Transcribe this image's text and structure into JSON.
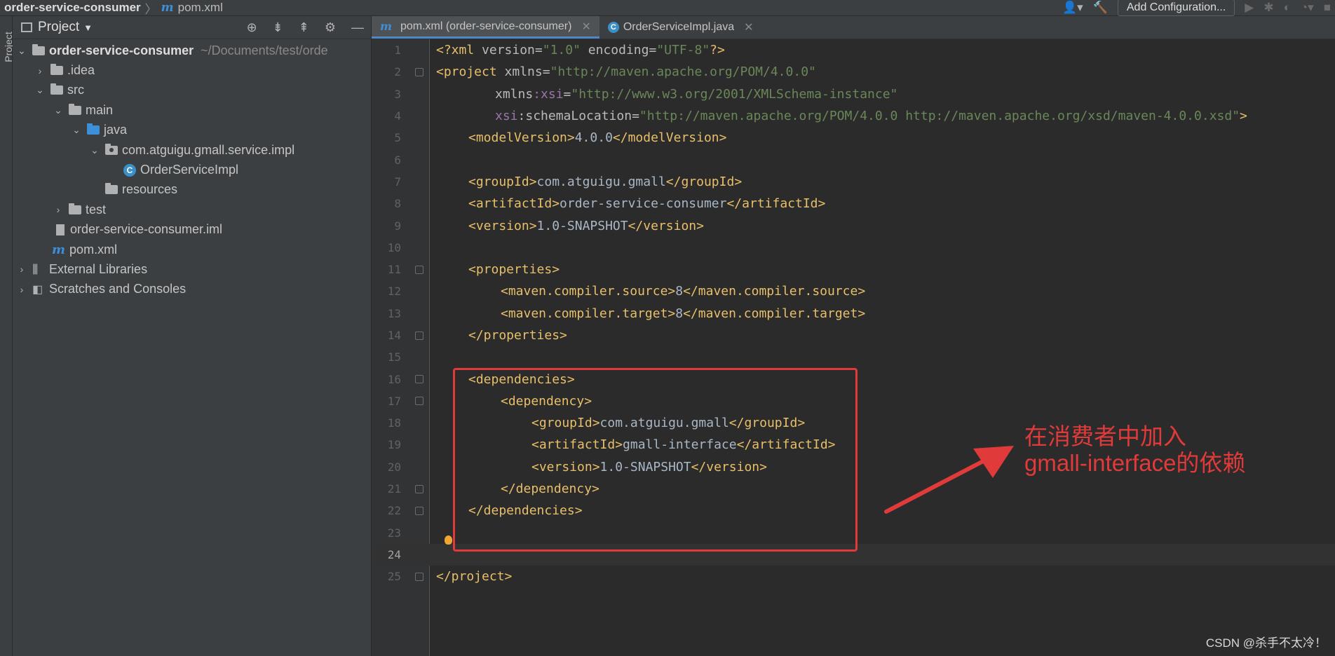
{
  "breadcrumb": {
    "project": "order-service-consumer",
    "file": "pom.xml"
  },
  "toolbar": {
    "add_config": "Add Configuration..."
  },
  "project_panel": {
    "title": "Project",
    "tree": [
      {
        "label": "order-service-consumer",
        "path": "~/Documents/test/orde"
      },
      {
        "label": ".idea"
      },
      {
        "label": "src"
      },
      {
        "label": "main"
      },
      {
        "label": "java"
      },
      {
        "label": "com.atguigu.gmall.service.impl"
      },
      {
        "label": "OrderServiceImpl"
      },
      {
        "label": "resources"
      },
      {
        "label": "test"
      },
      {
        "label": "order-service-consumer.iml"
      },
      {
        "label": "pom.xml"
      },
      {
        "label": "External Libraries"
      },
      {
        "label": "Scratches and Consoles"
      }
    ]
  },
  "tabs": [
    {
      "label": "pom.xml (order-service-consumer)"
    },
    {
      "label": "OrderServiceImpl.java"
    }
  ],
  "code_lines": [
    "1",
    "2",
    "3",
    "4",
    "5",
    "6",
    "7",
    "8",
    "9",
    "10",
    "11",
    "12",
    "13",
    "14",
    "15",
    "16",
    "17",
    "18",
    "19",
    "20",
    "21",
    "22",
    "23",
    "24",
    "25"
  ],
  "code": {
    "l1": {
      "a": "<?xml ",
      "b": "version",
      "c": "=",
      "d": "\"1.0\"",
      "e": " encoding",
      "f": "=",
      "g": "\"UTF-8\"",
      "h": "?>"
    },
    "l2": {
      "a": "<project ",
      "b": "xmlns",
      "c": "=",
      "d": "\"http://maven.apache.org/POM/4.0.0\""
    },
    "l3": {
      "a": "xmlns",
      "b": ":xsi",
      "c": "=",
      "d": "\"http://www.w3.org/2001/XMLSchema-instance\""
    },
    "l4": {
      "a": "xsi",
      "b": ":schemaLocation",
      "c": "=",
      "d": "\"http://maven.apache.org/POM/4.0.0 http://maven.apache.org/xsd/maven-4.0.0.xsd\"",
      "e": ">"
    },
    "l5": {
      "open": "<modelVersion>",
      "text": "4.0.0",
      "close": "</modelVersion>"
    },
    "l7": {
      "open": "<groupId>",
      "text": "com.atguigu.gmall",
      "close": "</groupId>"
    },
    "l8": {
      "open": "<artifactId>",
      "text": "order-service-consumer",
      "close": "</artifactId>"
    },
    "l9": {
      "open": "<version>",
      "text": "1.0-SNAPSHOT",
      "close": "</version>"
    },
    "l11": "<properties>",
    "l12": {
      "open": "<maven.compiler.source>",
      "text": "8",
      "close": "</maven.compiler.source>"
    },
    "l13": {
      "open": "<maven.compiler.target>",
      "text": "8",
      "close": "</maven.compiler.target>"
    },
    "l14": "</properties>",
    "l16": "<dependencies>",
    "l17": "<dependency>",
    "l18": {
      "open": "<groupId>",
      "text": "com.atguigu.gmall",
      "close": "</groupId>"
    },
    "l19": {
      "open": "<artifactId>",
      "text": "gmall-interface",
      "close": "</artifactId>"
    },
    "l20": {
      "open": "<version>",
      "text": "1.0-SNAPSHOT",
      "close": "</version>"
    },
    "l21": "</dependency>",
    "l22": "</dependencies>",
    "l25": "</project>"
  },
  "annotation": {
    "line1": "在消费者中加入",
    "line2": "gmall-interface的依赖",
    "color": "#e03a3a"
  },
  "watermark": "CSDN @杀手不太冷！"
}
